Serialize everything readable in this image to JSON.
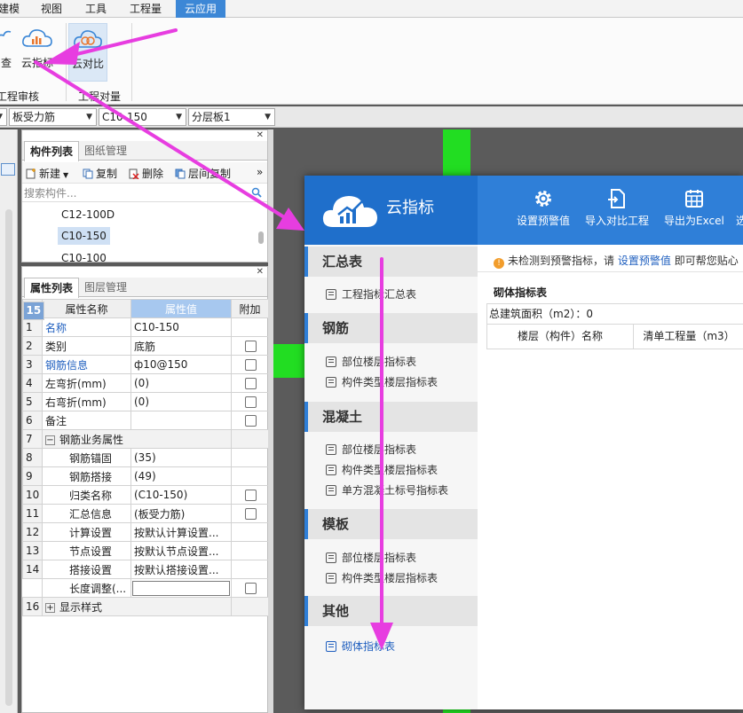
{
  "menubar": {
    "items": [
      "建模",
      "视图",
      "工具",
      "工程量",
      "云应用"
    ],
    "active_index": 4
  },
  "ribbon": {
    "buttons": [
      {
        "label": "查",
        "icon": "cloud-check-icon"
      },
      {
        "label": "云指标",
        "icon": "cloud-chart-icon"
      },
      {
        "label": "云对比",
        "icon": "cloud-compare-icon"
      }
    ],
    "groups": [
      "工程审核",
      "工程对量"
    ]
  },
  "selectors": [
    "板受力筋",
    "C10-150",
    "分层板1"
  ],
  "component_list": {
    "tabs": [
      "构件列表",
      "图纸管理"
    ],
    "toolbar": {
      "new": "新建",
      "copy": "复制",
      "delete": "删除",
      "floor_copy": "层间复制",
      "more": "»"
    },
    "search_placeholder": "搜索构件...",
    "items": [
      "C12-100D",
      "C10-150",
      "C10-100"
    ],
    "selected_index": 1
  },
  "property_panel": {
    "tabs": [
      "属性列表",
      "图层管理"
    ],
    "headers": [
      "属性名称",
      "属性值",
      "附加"
    ],
    "rows": [
      {
        "num": "1",
        "name": "名称",
        "value": "C10-150"
      },
      {
        "num": "2",
        "name": "类别",
        "value": "底筋"
      },
      {
        "num": "3",
        "name": "钢筋信息",
        "value": "ф10@150"
      },
      {
        "num": "4",
        "name": "左弯折(mm)",
        "value": "(0)"
      },
      {
        "num": "5",
        "name": "右弯折(mm)",
        "value": "(0)"
      },
      {
        "num": "6",
        "name": "备注",
        "value": ""
      },
      {
        "num": "7",
        "name": "钢筋业务属性",
        "value": "",
        "expander": "−"
      },
      {
        "num": "8",
        "name": "钢筋锚固",
        "value": "(35)"
      },
      {
        "num": "9",
        "name": "钢筋搭接",
        "value": "(49)"
      },
      {
        "num": "10",
        "name": "归类名称",
        "value": "(C10-150)"
      },
      {
        "num": "11",
        "name": "汇总信息",
        "value": "(板受力筋)"
      },
      {
        "num": "12",
        "name": "计算设置",
        "value": "按默认计算设置..."
      },
      {
        "num": "13",
        "name": "节点设置",
        "value": "按默认节点设置..."
      },
      {
        "num": "14",
        "name": "搭接设置",
        "value": "按默认搭接设置..."
      },
      {
        "num": "15",
        "name": "长度调整(...",
        "value": ""
      },
      {
        "num": "16",
        "name": "显示样式",
        "value": "",
        "expander": "+"
      }
    ]
  },
  "cloud_window": {
    "title": "云指标",
    "toolbar": [
      {
        "label": "设置预警值",
        "icon": "gear-icon"
      },
      {
        "label": "导入对比工程",
        "icon": "import-icon"
      },
      {
        "label": "导出为Excel",
        "icon": "excel-export-icon"
      },
      {
        "label": "选",
        "icon": "select-icon"
      }
    ],
    "sections": [
      {
        "title": "汇总表",
        "links": [
          "工程指标汇总表"
        ]
      },
      {
        "title": "钢筋",
        "links": [
          "部位楼层指标表",
          "构件类型楼层指标表"
        ]
      },
      {
        "title": "混凝土",
        "links": [
          "部位楼层指标表",
          "构件类型楼层指标表",
          "单方混凝土标号指标表"
        ]
      },
      {
        "title": "模板",
        "links": [
          "部位楼层指标表",
          "构件类型楼层指标表"
        ]
      },
      {
        "title": "其他",
        "links": [
          "砌体指标表"
        ]
      }
    ],
    "notice": {
      "prefix": "未检测到预警指标，请",
      "link": "设置预警值",
      "suffix": "即可帮您贴心"
    },
    "subtitle": "砌体指标表",
    "area_label": "总建筑面积（m2）：0",
    "grid_headers": [
      "楼层（构件）名称",
      "清单工程量（m3）"
    ]
  },
  "colors": {
    "accent": "#2f7fd8",
    "arrow": "#e73de0",
    "highlight_green": "#22dd22"
  }
}
